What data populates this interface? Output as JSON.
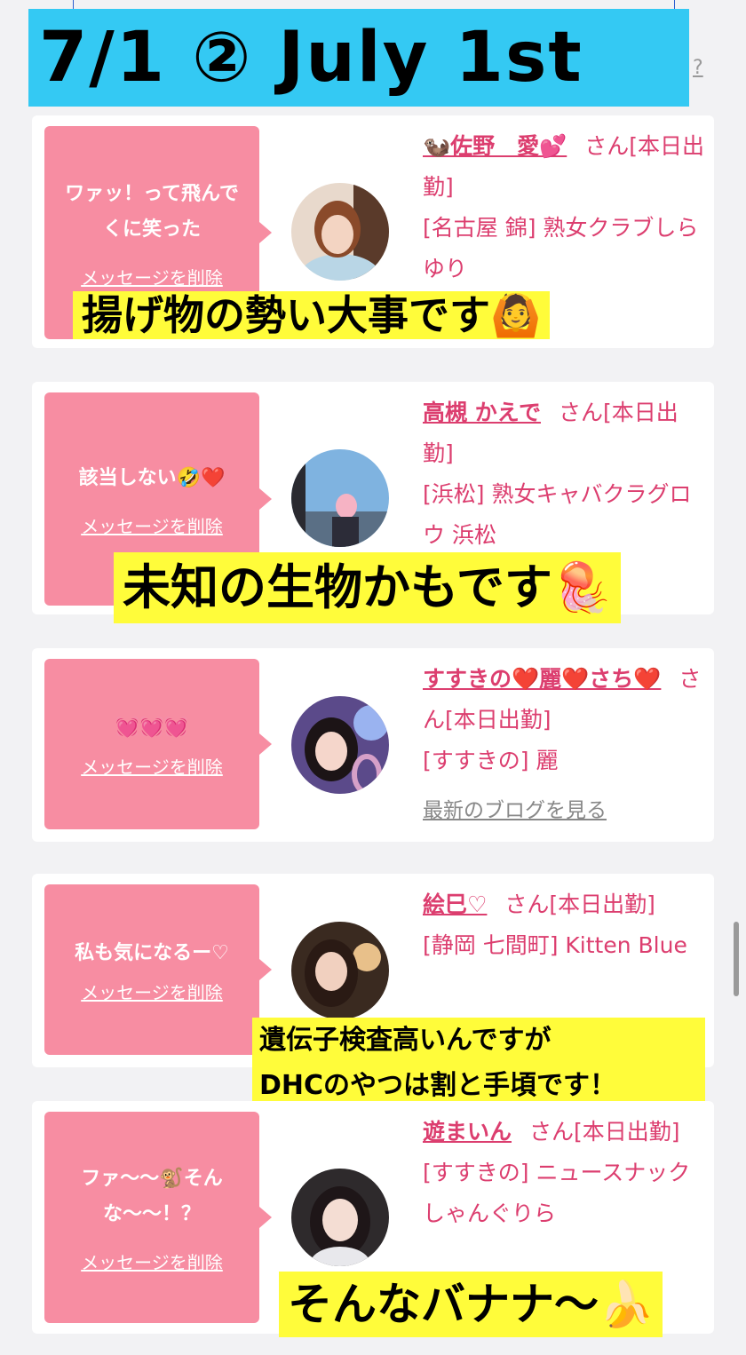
{
  "header": {
    "title": "7/1 ② July 1st",
    "help": "?"
  },
  "cards": [
    {
      "message": "ワァッ！って飛んでくに笑った",
      "delete_label": "メッセージを削除",
      "name": "🦦佐野　愛💕",
      "suffix": "さん[本日出勤]",
      "shop": "[名古屋 錦] 熟女クラブしらゆり",
      "caption": "揚げ物の勢い大事です🙆"
    },
    {
      "message": "該当しない🤣❤️",
      "delete_label": "メッセージを削除",
      "name": "高槻 かえで",
      "suffix": "さん[本日出勤]",
      "shop": "[浜松] 熟女キャバクラグロウ 浜松",
      "caption": "未知の生物かもです🪼"
    },
    {
      "message": "💓💓💓",
      "delete_label": "メッセージを削除",
      "name": "すすきの❤️麗❤️さち❤️",
      "suffix": "さん[本日出勤]",
      "shop": "[すすきの] 麗",
      "blog_link": "最新のブログを見る"
    },
    {
      "message": "私も気になるー♡",
      "delete_label": "メッセージを削除",
      "name": "絵巳♡",
      "suffix": "さん[本日出勤]",
      "shop": "[静岡 七間町] Kitten Blue",
      "caption_line1": "遺伝子検査高いんですが",
      "caption_line2": "DHCのやつは割と手頃です！"
    },
    {
      "message": "ファ〜〜🐒そんな〜〜！？",
      "delete_label": "メッセージを削除",
      "name": "遊まいん",
      "suffix": "さん[本日出勤]",
      "shop": "[すすきの] ニュースナックしゃんぐりら",
      "caption": "そんなバナナ〜🍌"
    }
  ],
  "colors": {
    "bubble": "#f78da2",
    "accent": "#dc3e6f",
    "banner": "#34c9f3",
    "caption_bg": "#fffc3a"
  }
}
